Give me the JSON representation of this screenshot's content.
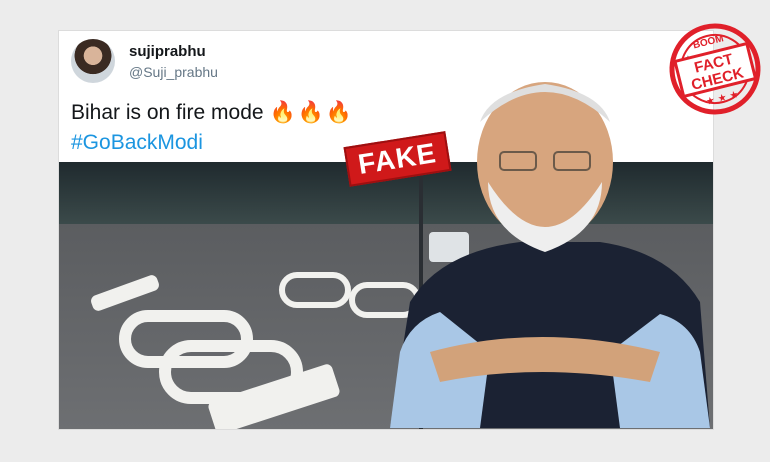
{
  "tweet": {
    "display_name": "sujiprabhu",
    "handle": "@Suji_prabhu",
    "text": "Bihar is on fire mode",
    "emoji": "🔥🔥🔥",
    "hashtag": "#GoBackModi",
    "menu_icon": "chevron-down-icon"
  },
  "overlay": {
    "fake_label": "FAKE",
    "stamp_top": "BOOM",
    "stamp_line1": "FACT",
    "stamp_line2": "CHECK",
    "stamp_stars": "★ ★ ★"
  },
  "colors": {
    "hashtag": "#1b95e0",
    "fake": "#d0191a",
    "stamp": "#e0202a"
  }
}
